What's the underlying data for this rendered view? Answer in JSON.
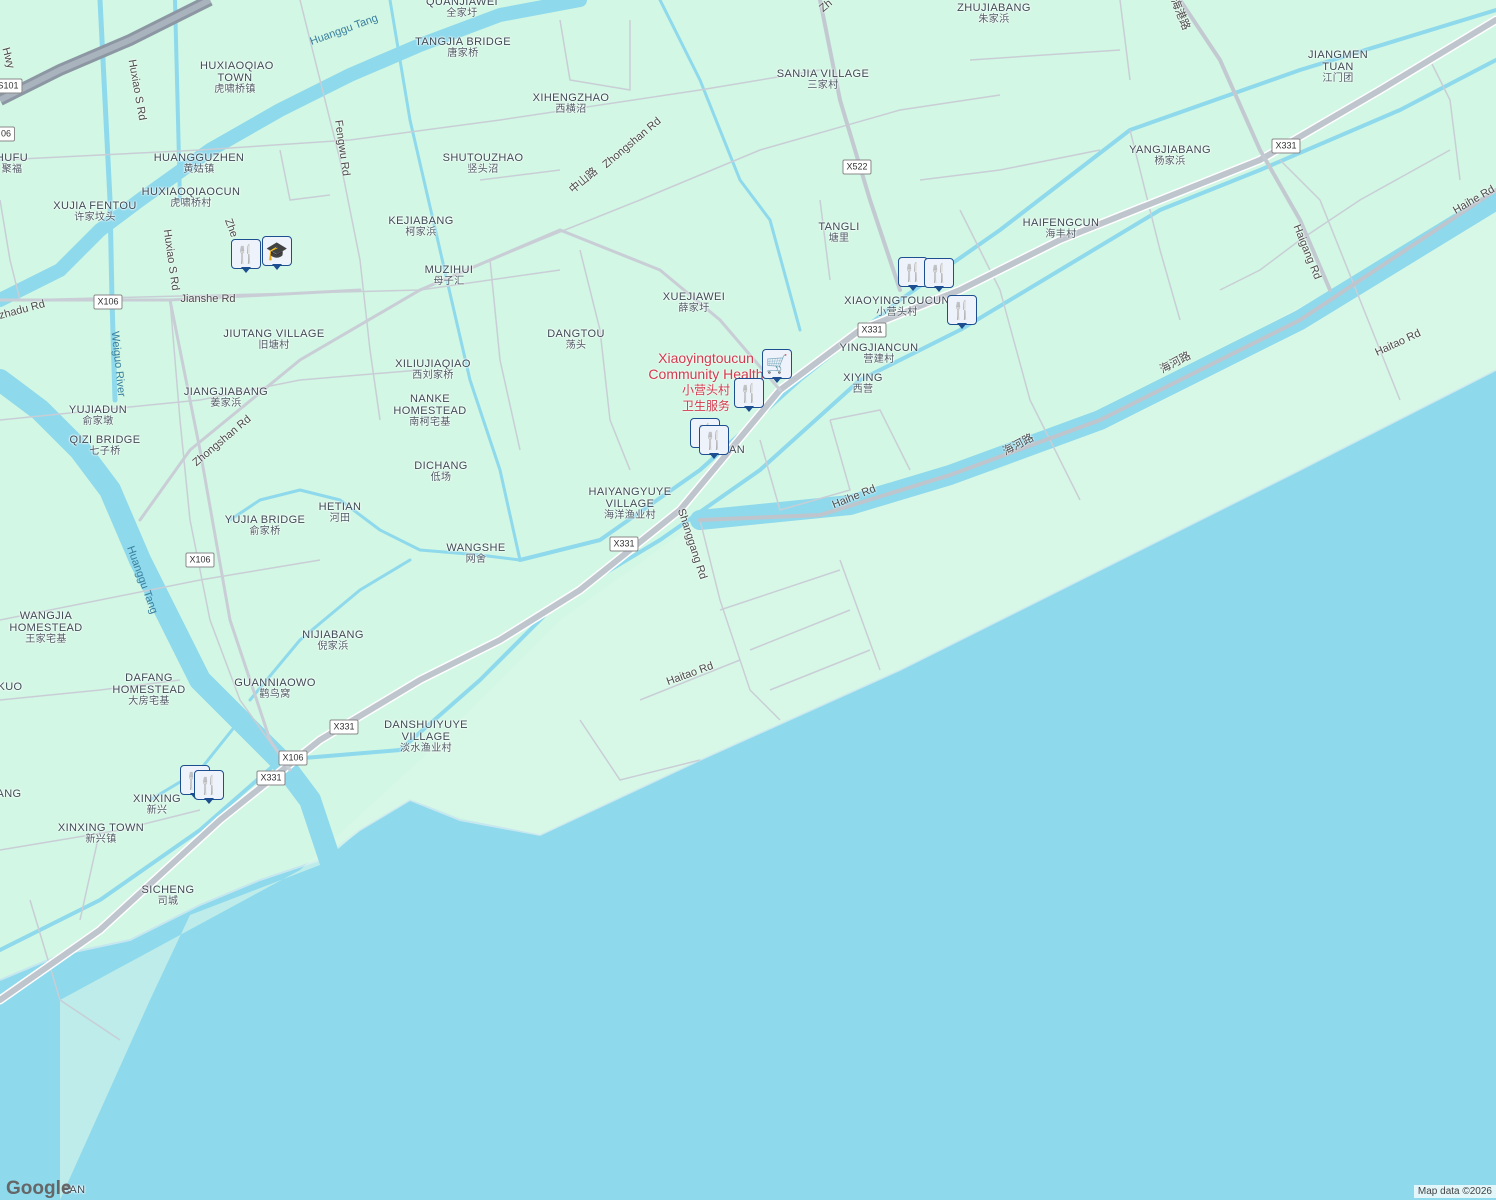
{
  "map": {
    "colors": {
      "land": "#d2f7e4",
      "water": "#8ed9ec",
      "river": "#8ed9ec",
      "road": "#c9ced6",
      "major_road": "#b9bfc8",
      "highway": "#8c97a3",
      "poi": "#d23a4d",
      "marker": "#1d4e8f"
    },
    "places": [
      {
        "id": "quanjiawei",
        "name": "QUANJIAWEI",
        "cn": "全家圩"
      },
      {
        "id": "tangjia",
        "name": "TANGJIA BRIDGE",
        "cn": "唐家桥"
      },
      {
        "id": "huxiaoqiao-town",
        "name": "HUXIAOQIAO TOWN",
        "cn": "虎啸桥镇"
      },
      {
        "id": "xihengzhao",
        "name": "XIHENGZHAO",
        "cn": "西横沼"
      },
      {
        "id": "shutouzhao",
        "name": "SHUTOUZHAO",
        "cn": "竖头沼"
      },
      {
        "id": "huangguzhen",
        "name": "HUANGGUZHEN",
        "cn": "黄姑镇"
      },
      {
        "id": "huxiaoqiaocun",
        "name": "HUXIAOQIAOCUN",
        "cn": "虎啸桥村"
      },
      {
        "id": "xujia-fentou",
        "name": "XUJIA FENTOU",
        "cn": "许家坟头"
      },
      {
        "id": "hufu",
        "name": "HUFU",
        "cn": "聚福"
      },
      {
        "id": "kejiabang",
        "name": "KEJIABANG",
        "cn": "柯家浜"
      },
      {
        "id": "muzihui",
        "name": "MUZIHUI",
        "cn": "母子汇"
      },
      {
        "id": "xuejiawei",
        "name": "XUEJIAWEI",
        "cn": "薛家圩"
      },
      {
        "id": "dangtou",
        "name": "DANGTOU",
        "cn": "荡头"
      },
      {
        "id": "jiutang",
        "name": "JIUTANG VILLAGE",
        "cn": "旧塘村"
      },
      {
        "id": "xiliujiaqiao",
        "name": "XILIUJIAQIAO",
        "cn": "西刘家桥"
      },
      {
        "id": "jiangjiabang",
        "name": "JIANGJIABANG",
        "cn": "姜家浜"
      },
      {
        "id": "nanke",
        "name": "NANKE HOMESTEAD",
        "cn": "南柯宅基"
      },
      {
        "id": "yujiadun",
        "name": "YUJIADUN",
        "cn": "俞家墩"
      },
      {
        "id": "qizi",
        "name": "QIZI BRIDGE",
        "cn": "七子桥"
      },
      {
        "id": "dichang",
        "name": "DICHANG",
        "cn": "低场"
      },
      {
        "id": "haiyangyuye",
        "name": "HAIYANGYUYE VILLAGE",
        "cn": "海洋渔业村"
      },
      {
        "id": "hetian",
        "name": "HETIAN",
        "cn": "河田"
      },
      {
        "id": "yujia-bridge",
        "name": "YUJIA BRIDGE",
        "cn": "俞家桥"
      },
      {
        "id": "wangshe",
        "name": "WANGSHE",
        "cn": "网舍"
      },
      {
        "id": "wangjia",
        "name": "WANGJIA HOMESTEAD",
        "cn": "王家宅基"
      },
      {
        "id": "nijiabang",
        "name": "NIJIABANG",
        "cn": "倪家浜"
      },
      {
        "id": "dafang",
        "name": "DAFANG HOMESTEAD",
        "cn": "大房宅基"
      },
      {
        "id": "guanniaowo",
        "name": "GUANNIAOWO",
        "cn": "鹳鸟窝"
      },
      {
        "id": "danshuiyuye",
        "name": "DANSHUIYUYE VILLAGE",
        "cn": "淡水渔业村"
      },
      {
        "id": "xinxing",
        "name": "XINXING",
        "cn": "新兴"
      },
      {
        "id": "xinxing-town",
        "name": "XINXING TOWN",
        "cn": "新兴镇"
      },
      {
        "id": "sicheng",
        "name": "SICHENG",
        "cn": "司城"
      },
      {
        "id": "zhujiabang",
        "name": "ZHUJIABANG",
        "cn": "朱家浜"
      },
      {
        "id": "sanjia",
        "name": "SANJIA VILLAGE",
        "cn": "三家村"
      },
      {
        "id": "jiangmen",
        "name": "JIANGMEN TUAN",
        "cn": "江门团"
      },
      {
        "id": "yangjiabang",
        "name": "YANGJIABANG",
        "cn": "杨家浜"
      },
      {
        "id": "tangli",
        "name": "TANGLI",
        "cn": "塘里"
      },
      {
        "id": "haifengcun",
        "name": "HAIFENGCUN",
        "cn": "海丰村"
      },
      {
        "id": "xiaoyingtoucun",
        "name": "XIAOYINGTOUCUN",
        "cn": "小营头村"
      },
      {
        "id": "yingjiancun",
        "name": "YINGJIANCUN",
        "cn": "营建村"
      },
      {
        "id": "xiying",
        "name": "XIYING",
        "cn": "西营"
      },
      {
        "id": "ang",
        "name": "ANG",
        "cn": ""
      },
      {
        "id": "kuo",
        "name": "KUO",
        "cn": ""
      },
      {
        "id": "an",
        "name": "AN",
        "cn": ""
      },
      {
        "id": "pan",
        "name": "PAN",
        "cn": ""
      }
    ],
    "roads": [
      {
        "id": "zhongshan1",
        "name": "Zhongshan Rd"
      },
      {
        "id": "zhongshan-cn",
        "name": "中山路"
      },
      {
        "id": "zhongshan2",
        "name": "Zhongshan Rd"
      },
      {
        "id": "fengwu",
        "name": "Fengwu Rd"
      },
      {
        "id": "huxiao1",
        "name": "Huxiao S Rd"
      },
      {
        "id": "huxiao2",
        "name": "Huxiao S Rd"
      },
      {
        "id": "jianshe",
        "name": "Jianshe Rd"
      },
      {
        "id": "haihe",
        "name": "Haihe Rd"
      },
      {
        "id": "haihe-cn",
        "name": "海河路"
      },
      {
        "id": "haihe-cn2",
        "name": "海河路"
      },
      {
        "id": "haihe2",
        "name": "Haihe Rd"
      },
      {
        "id": "haitao",
        "name": "Haitao Rd"
      },
      {
        "id": "haitao2",
        "name": "Haitao Rd"
      },
      {
        "id": "shanggang",
        "name": "Shanggang Rd"
      },
      {
        "id": "haigang",
        "name": "Haigang Rd"
      },
      {
        "id": "haigang-cn",
        "name": "海港路"
      },
      {
        "id": "zhehadu",
        "name": "zhadu Rd"
      },
      {
        "id": "zhe",
        "name": "Zhe"
      },
      {
        "id": "zh",
        "name": "Zh"
      },
      {
        "id": "hwy",
        "name": "Hwy"
      }
    ],
    "water_labels": [
      {
        "id": "huanggu-tang-top",
        "name": "Huanggu Tang"
      },
      {
        "id": "huanggu-tang-left",
        "name": "Huanggu Tang"
      },
      {
        "id": "weiguo-river",
        "name": "Weiguo River"
      }
    ],
    "shields": [
      "X331",
      "X331",
      "X331",
      "X331",
      "X331",
      "X331",
      "X106",
      "X106",
      "X106",
      "X522",
      "S101",
      "06"
    ],
    "poi": {
      "name_line1": "Xiaoyingtoucun",
      "name_line2": "Community Health",
      "cn_line1": "小营头村",
      "cn_line2": "卫生服务"
    },
    "markers": [
      {
        "type": "restaurant",
        "icon": "fork-knife-icon"
      },
      {
        "type": "school",
        "icon": "graduation-cap-icon"
      },
      {
        "type": "restaurant",
        "icon": "fork-knife-icon"
      },
      {
        "type": "restaurant",
        "icon": "fork-knife-icon"
      },
      {
        "type": "restaurant",
        "icon": "fork-knife-icon"
      },
      {
        "type": "shopping",
        "icon": "shopping-cart-icon"
      },
      {
        "type": "restaurant",
        "icon": "fork-knife-icon"
      },
      {
        "type": "restaurant",
        "icon": "fork-knife-icon"
      },
      {
        "type": "restaurant",
        "icon": "fork-knife-icon"
      },
      {
        "type": "restaurant",
        "icon": "fork-knife-icon"
      },
      {
        "type": "restaurant",
        "icon": "fork-knife-icon"
      }
    ],
    "attribution": "Map data ©2026",
    "logo": "Google"
  }
}
